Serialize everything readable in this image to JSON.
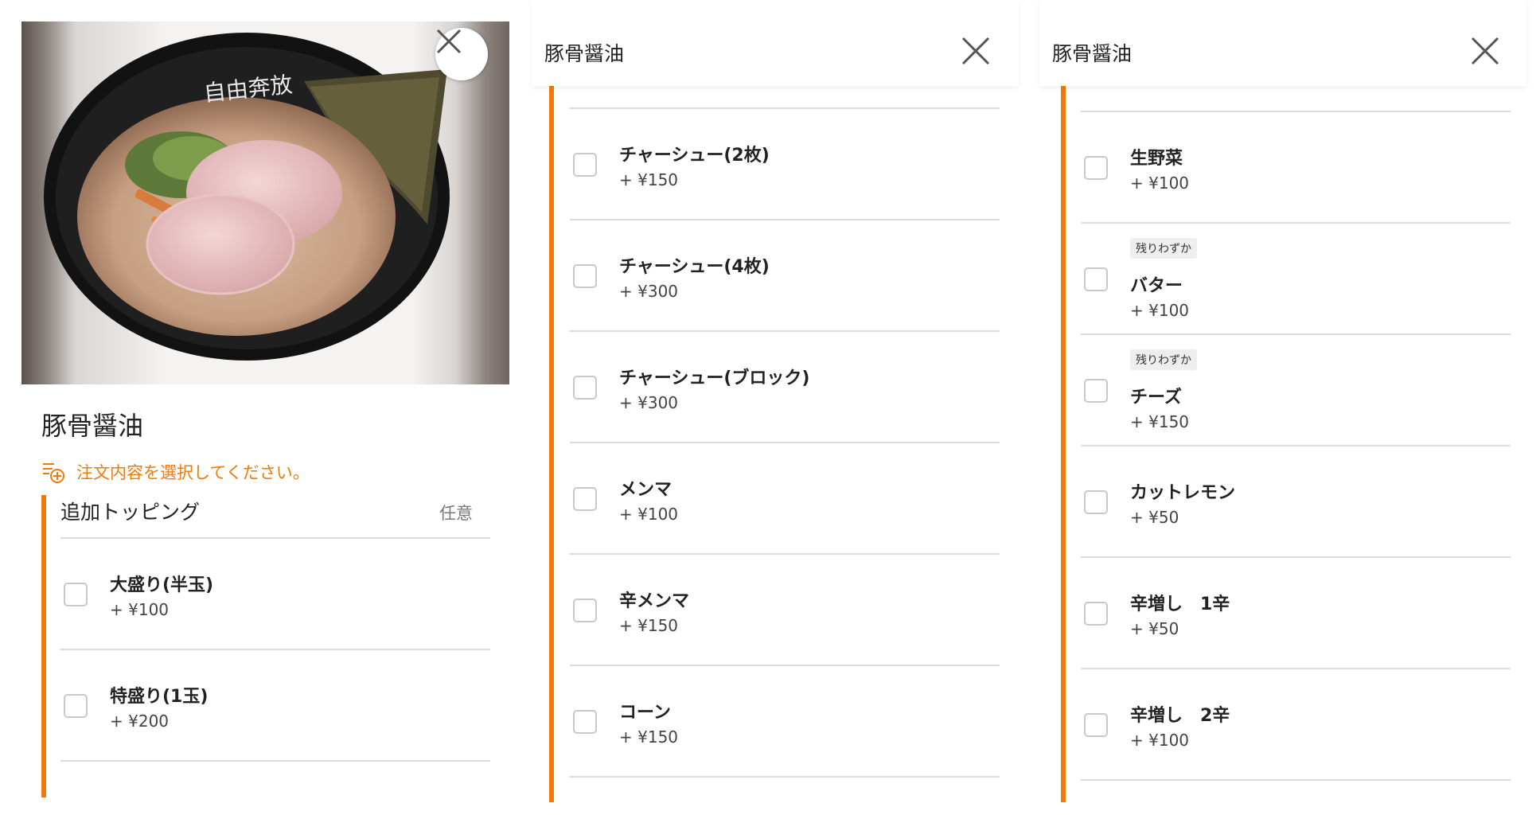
{
  "product": {
    "name": "豚骨醤油",
    "notice": "注文内容を選択してください。"
  },
  "section": {
    "title": "追加トッピング",
    "optional_label": "任意"
  },
  "panel1_items": [
    {
      "name": "大盛り(半玉)",
      "price": "+ ¥100"
    },
    {
      "name": "特盛り(1玉)",
      "price": "+ ¥200"
    }
  ],
  "panel2_items": [
    {
      "name": "チャーシュー(2枚)",
      "price": "+ ¥150"
    },
    {
      "name": "チャーシュー(4枚)",
      "price": "+ ¥300"
    },
    {
      "name": "チャーシュー(ブロック)",
      "price": "+ ¥300"
    },
    {
      "name": "メンマ",
      "price": "+ ¥100"
    },
    {
      "name": "辛メンマ",
      "price": "+ ¥150"
    },
    {
      "name": "コーン",
      "price": "+ ¥150"
    }
  ],
  "panel3_items": [
    {
      "name": "生野菜",
      "price": "+ ¥100",
      "badge": ""
    },
    {
      "name": "バター",
      "price": "+ ¥100",
      "badge": "残りわずか"
    },
    {
      "name": "チーズ",
      "price": "+ ¥150",
      "badge": "残りわずか"
    },
    {
      "name": "カットレモン",
      "price": "+ ¥50",
      "badge": ""
    },
    {
      "name": "辛増し　1辛",
      "price": "+ ¥50",
      "badge": ""
    },
    {
      "name": "辛増し　2辛",
      "price": "+ ¥100",
      "badge": ""
    }
  ],
  "icons": {
    "close": "close-icon",
    "notice": "list-add-icon"
  },
  "colors": {
    "accent": "#f07a0c",
    "divider": "#dcdcdc",
    "checkbox_border": "#c9c9c9"
  }
}
